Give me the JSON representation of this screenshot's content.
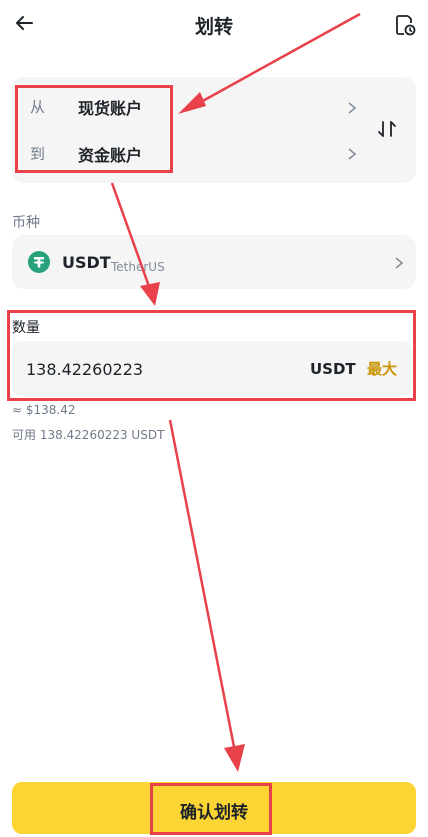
{
  "header": {
    "title": "划转"
  },
  "transfer": {
    "from_label": "从",
    "from_value": "现货账户",
    "to_label": "到",
    "to_value": "资金账户"
  },
  "coin": {
    "section_label": "币种",
    "symbol": "USDT",
    "name": "TetherUS"
  },
  "amount": {
    "section_label": "数量",
    "value": "138.42260223",
    "unit": "USDT",
    "max_label": "最大",
    "approx": "≈ $138.42",
    "available": "可用 138.42260223 USDT"
  },
  "confirm": {
    "label": "确认划转"
  },
  "colors": {
    "accent_yellow": "#fcd535",
    "max_text": "#c99400",
    "annotation_red": "#e8414a",
    "tether_green": "#26a17b"
  },
  "icons": [
    "back-arrow-icon",
    "history-icon",
    "chevron-right-icon",
    "swap-icon",
    "tether-icon"
  ]
}
